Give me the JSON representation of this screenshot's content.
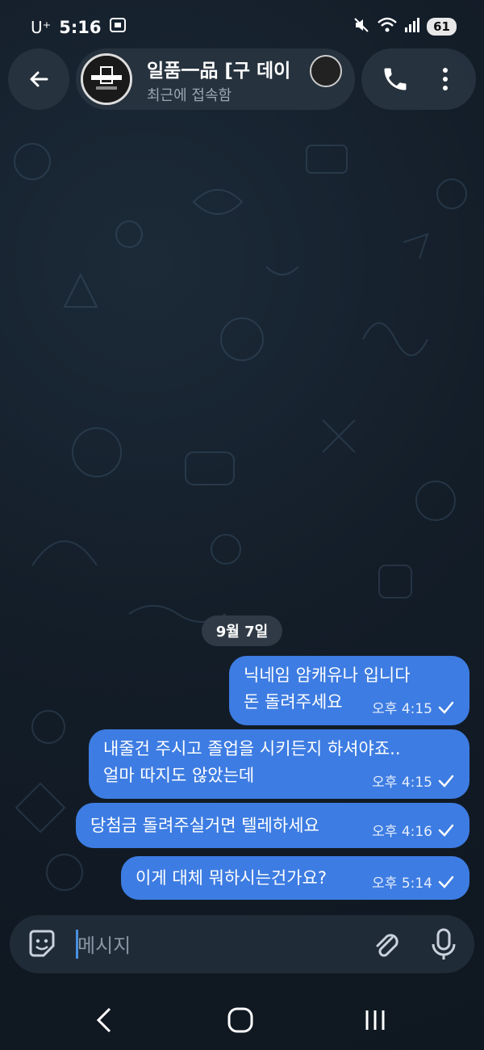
{
  "status_bar": {
    "carrier": "U⁺",
    "time": "5:16",
    "battery": "61"
  },
  "header": {
    "title": "일품一品 [구 데이",
    "subtitle": "최근에 접속함",
    "icons": [
      "back-arrow-icon",
      "phone-icon",
      "more-vertical-icon"
    ]
  },
  "chat": {
    "date_label": "9월 7일",
    "messages": [
      {
        "text": "닉네임 암캐유나 입니다\n돈 돌려주세요",
        "time": "오후 4:15"
      },
      {
        "text": "내줄건 주시고 졸업을 시키든지 하셔야죠..\n얼마 따지도 않았는데",
        "time": "오후 4:15"
      },
      {
        "text": "당첨금 돌려주실거면 텔레하세요",
        "time": "오후 4:16"
      },
      {
        "text": "이게 대체 뭐하시는건가요?",
        "time": "오후 5:14"
      }
    ]
  },
  "input": {
    "placeholder": "메시지"
  },
  "colors": {
    "bubble": "#3d7ce2",
    "background": "#131d28",
    "accent": "#4a90e2"
  }
}
